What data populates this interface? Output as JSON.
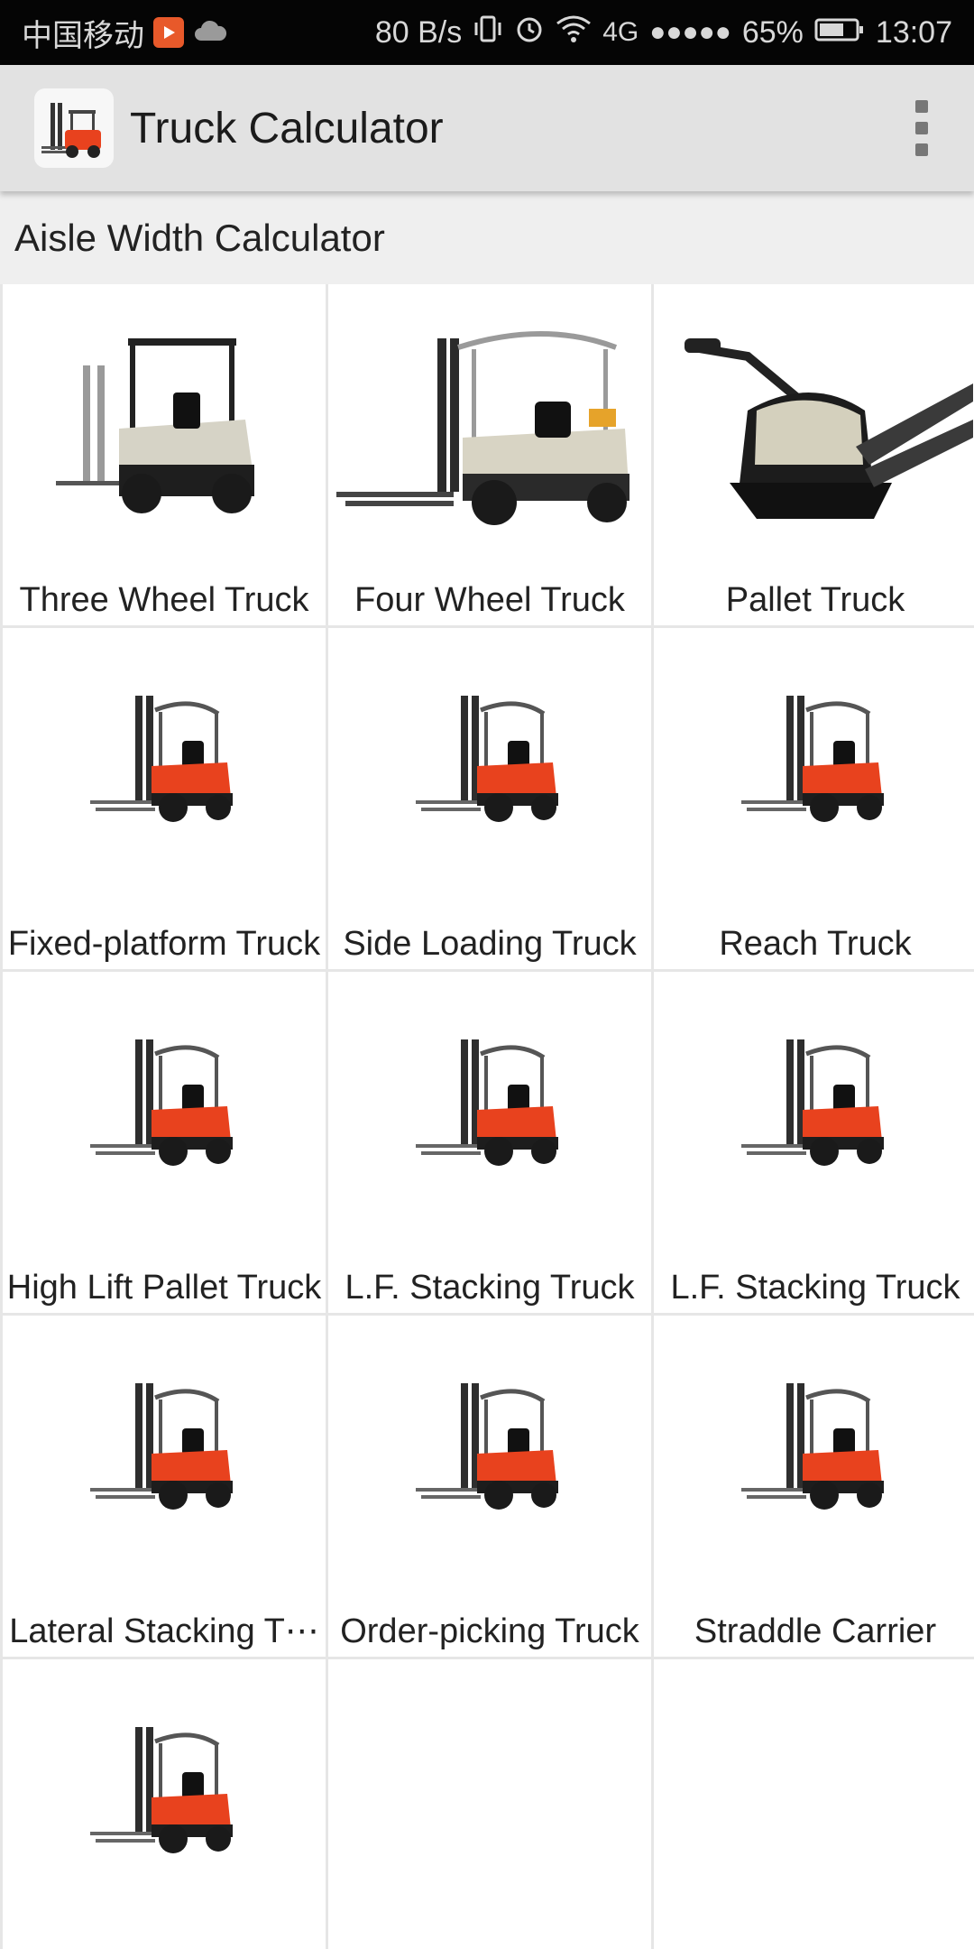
{
  "status_bar": {
    "carrier": "中国移动",
    "network_speed": "80 B/s",
    "network_type": "4G",
    "signal": "●●●●●",
    "battery": "65%",
    "time": "13:07"
  },
  "app_bar": {
    "title": "Truck Calculator",
    "menu_icon": "overflow-menu-icon"
  },
  "section": {
    "title": "Aisle Width Calculator"
  },
  "trucks": [
    {
      "label": "Three Wheel Truck",
      "image": "three-wheel-forklift"
    },
    {
      "label": "Four Wheel Truck",
      "image": "four-wheel-forklift"
    },
    {
      "label": "Pallet Truck",
      "image": "pallet-truck"
    },
    {
      "label": "Fixed-platform Truck",
      "image": "generic-forklift"
    },
    {
      "label": "Side Loading Truck",
      "image": "generic-forklift"
    },
    {
      "label": "Reach Truck",
      "image": "generic-forklift"
    },
    {
      "label": "High Lift Pallet Truck",
      "image": "generic-forklift"
    },
    {
      "label": "L.F. Stacking Truck",
      "image": "generic-forklift"
    },
    {
      "label": "L.F. Stacking Truck",
      "image": "generic-forklift"
    },
    {
      "label": "Lateral Stacking T⋯",
      "image": "generic-forklift"
    },
    {
      "label": "Order-picking Truck",
      "image": "generic-forklift"
    },
    {
      "label": "Straddle Carrier",
      "image": "generic-forklift"
    },
    {
      "label": "",
      "image": "generic-forklift"
    }
  ],
  "colors": {
    "status_bar_bg": "#050505",
    "app_bar_bg": "#e2e2e2",
    "section_bg": "#efefef",
    "forklift_body": "#e8421e"
  }
}
